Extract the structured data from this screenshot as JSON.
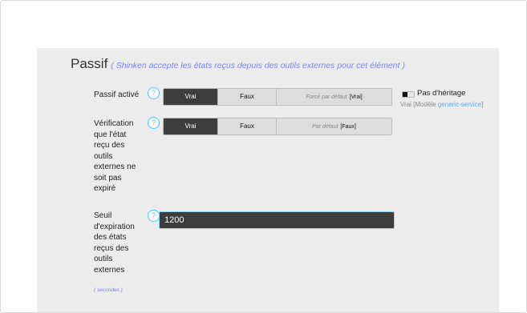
{
  "section": {
    "title": "Passif",
    "subtitle": "( Shinken accepte les états reçus depuis des outils externes pour cet élément )"
  },
  "passive_checks": {
    "label": "Passif activé",
    "help": "?",
    "options": [
      "Vrai",
      "Faux"
    ],
    "selected": "Vrai",
    "default_text": "Forcé par défaut",
    "default_value": "[Vrai]",
    "inheritance_label": "Pas d'héritage",
    "inherited_prefix": "Vrai [Modèle ",
    "inherited_template": "generic-service",
    "inherited_suffix": "]"
  },
  "freshness_check": {
    "label_lines": [
      "Vérification",
      "que l'état",
      "reçu des",
      "outils",
      "externes ne",
      "soit pas",
      "expiré"
    ],
    "help": "?",
    "options": [
      "Vrai",
      "Faux"
    ],
    "selected": "Vrai",
    "default_text": "Par défaut",
    "default_value": "[Faux]"
  },
  "freshness_threshold": {
    "label_lines": [
      "Seuil",
      "d'expiration",
      "des états",
      "reçus des",
      "outils",
      "externes"
    ],
    "unit": "( secondes )",
    "help": "?",
    "value": "1200"
  }
}
